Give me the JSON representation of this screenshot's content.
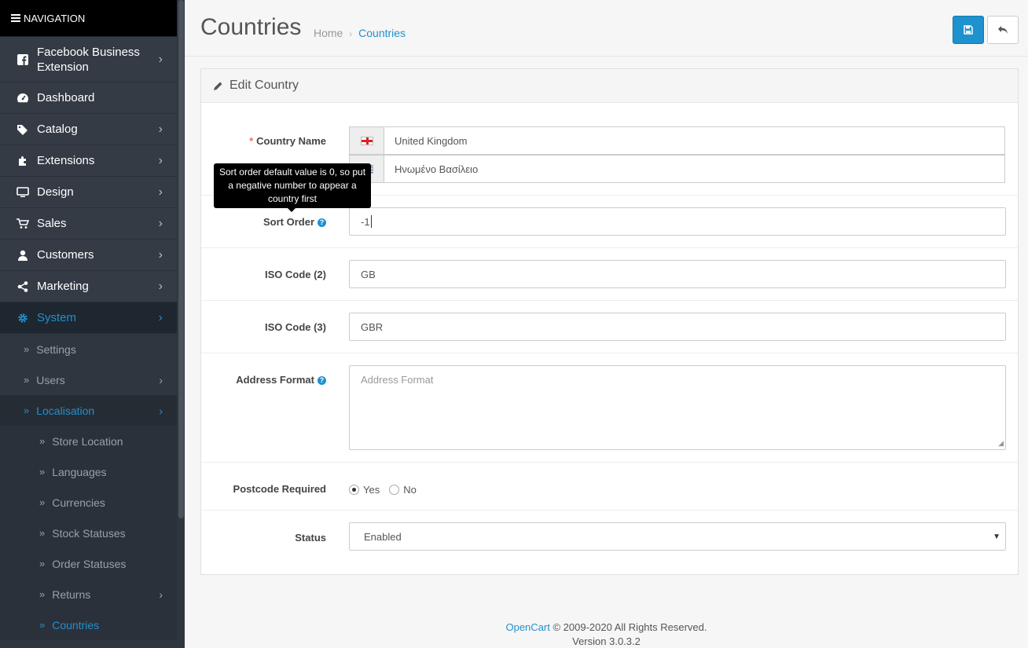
{
  "sidebar": {
    "header": "NAVIGATION",
    "items": [
      {
        "label": "Facebook Business Extension",
        "icon": "facebook-icon"
      },
      {
        "label": "Dashboard",
        "icon": "dashboard-icon"
      },
      {
        "label": "Catalog",
        "icon": "tags-icon"
      },
      {
        "label": "Extensions",
        "icon": "puzzle-icon"
      },
      {
        "label": "Design",
        "icon": "monitor-icon"
      },
      {
        "label": "Sales",
        "icon": "cart-icon"
      },
      {
        "label": "Customers",
        "icon": "user-icon"
      },
      {
        "label": "Marketing",
        "icon": "share-icon"
      },
      {
        "label": "System",
        "icon": "gear-icon"
      }
    ],
    "system_sub": [
      {
        "label": "Settings"
      },
      {
        "label": "Users"
      },
      {
        "label": "Localisation"
      }
    ],
    "localisation_sub": [
      {
        "label": "Store Location"
      },
      {
        "label": "Languages"
      },
      {
        "label": "Currencies"
      },
      {
        "label": "Stock Statuses"
      },
      {
        "label": "Order Statuses"
      },
      {
        "label": "Returns"
      },
      {
        "label": "Countries"
      }
    ]
  },
  "header": {
    "title": "Countries",
    "breadcrumb": [
      "Home",
      "Countries"
    ],
    "accent": "#1e91cf"
  },
  "panel": {
    "heading": "Edit Country",
    "country_name_label": "Country Name",
    "country_name_en": "United Kingdom",
    "country_name_gr": "Ηνωμένο Βασίλειο",
    "sort_order_label": "Sort Order",
    "sort_order_value": "-1",
    "tooltip": "Sort order default value is 0, so put a negative number to appear a country first",
    "iso2_label": "ISO Code (2)",
    "iso2_value": "GB",
    "iso3_label": "ISO Code (3)",
    "iso3_value": "GBR",
    "address_label": "Address Format",
    "address_placeholder": "Address Format",
    "postcode_label": "Postcode Required",
    "postcode_yes": "Yes",
    "postcode_no": "No",
    "status_label": "Status",
    "status_value": "Enabled"
  },
  "footer": {
    "link": "OpenCart",
    "copyright": "© 2009-2020 All Rights Reserved.",
    "version": "Version 3.0.3.2"
  }
}
